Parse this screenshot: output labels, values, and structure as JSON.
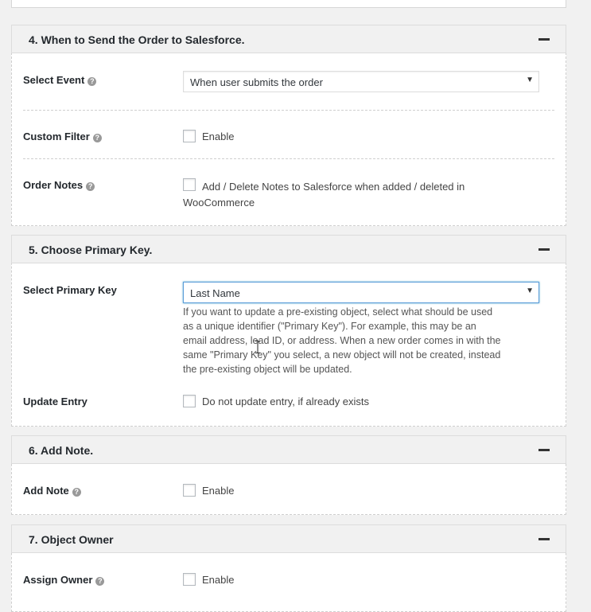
{
  "sections": [
    {
      "title": "4. When to Send the Order to Salesforce.",
      "select_event": {
        "label": "Select Event",
        "value": "When user submits the order"
      },
      "custom_filter": {
        "label": "Custom Filter",
        "checkbox_label": "Enable"
      },
      "order_notes": {
        "label": "Order Notes",
        "checkbox_label": "Add / Delete Notes to Salesforce when added / deleted in WooCommerce"
      }
    },
    {
      "title": "5. Choose Primary Key.",
      "select_primary_key": {
        "label": "Select Primary Key",
        "value": "Last Name",
        "description": "If you want to update a pre-existing object, select what should be used as a unique identifier (\"Primary Key\"). For example, this may be an email address, lead ID, or address. When a new order comes in with the same \"Primary Key\" you select, a new object will not be created, instead the pre-existing object will be updated."
      },
      "update_entry": {
        "label": "Update Entry",
        "checkbox_label": "Do not update entry, if already exists"
      }
    },
    {
      "title": "6. Add Note.",
      "add_note": {
        "label": "Add Note",
        "checkbox_label": "Enable"
      }
    },
    {
      "title": "7. Object Owner",
      "assign_owner": {
        "label": "Assign Owner",
        "checkbox_label": "Enable"
      }
    }
  ],
  "icons": {
    "help": "question-circle-icon",
    "collapse": "minus-icon",
    "dropdown": "chevron-down-icon"
  },
  "help_glyph": "?",
  "collapse_glyph": "−",
  "dropdown_glyph": "▼"
}
